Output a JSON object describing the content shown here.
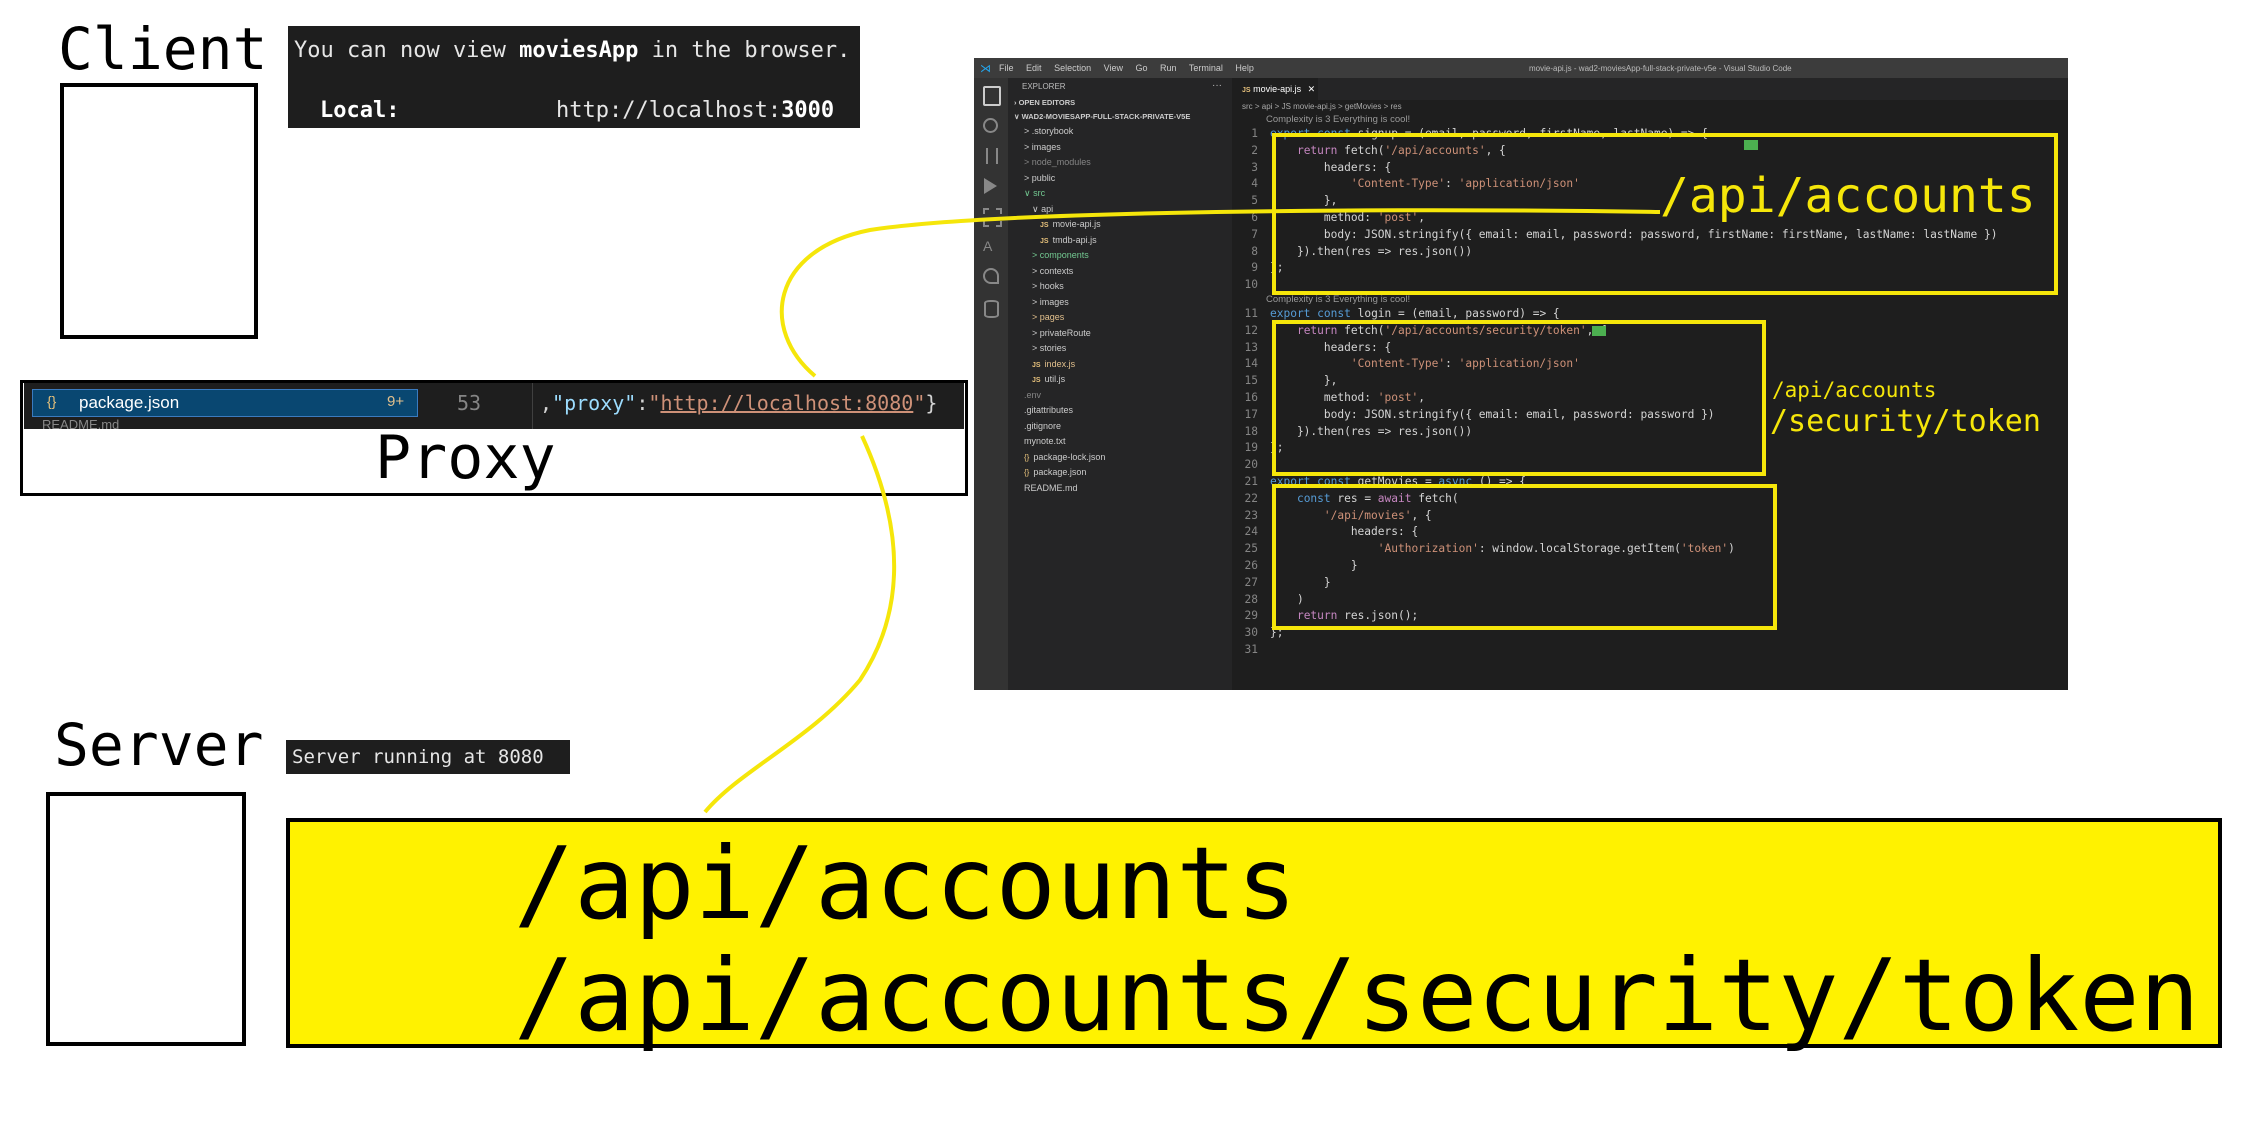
{
  "client": {
    "label": "Client",
    "terminal_line1_pre": "You can now view ",
    "terminal_line1_app": "moviesApp",
    "terminal_line1_post": " in the browser.",
    "terminal_local_label": "Local:",
    "terminal_local_url_pre": "http://localhost:",
    "terminal_local_url_port": "3000"
  },
  "proxy": {
    "label": "Proxy",
    "file_name": "package.json",
    "file_badge": "9+",
    "line_number": "53",
    "code_prefix": ",",
    "code_key": "\"proxy\"",
    "code_colon": ":",
    "code_value_quote_open": "\"",
    "code_value": "http://localhost:8080",
    "code_value_quote_close": "\"",
    "code_suffix": "}",
    "next_file_partial": "README.md"
  },
  "server": {
    "label": "Server",
    "terminal_text": "Server running at 8080"
  },
  "routes_box": {
    "line1": "/api/accounts",
    "line2": "/api/accounts/security/token"
  },
  "vscode": {
    "menu": [
      "File",
      "Edit",
      "Selection",
      "View",
      "Go",
      "Run",
      "Terminal",
      "Help"
    ],
    "window_title": "movie-api.js - wad2-moviesApp-full-stack-private-v5e - Visual Studio Code",
    "explorer_title": "EXPLORER",
    "open_editors": "OPEN EDITORS",
    "project_root": "WAD2-MOVIESAPP-FULL-STACK-PRIVATE-V5E",
    "tree": [
      {
        "label": "> .storybook",
        "indent": 1,
        "kind": "folder"
      },
      {
        "label": "> images",
        "indent": 1,
        "kind": "folder"
      },
      {
        "label": "> node_modules",
        "indent": 1,
        "kind": "muted"
      },
      {
        "label": "> public",
        "indent": 1,
        "kind": "folder"
      },
      {
        "label": "∨ src",
        "indent": 1,
        "kind": "green"
      },
      {
        "label": "∨ api",
        "indent": 2,
        "kind": "folder"
      },
      {
        "label": "movie-api.js",
        "indent": 3,
        "kind": "js"
      },
      {
        "label": "tmdb-api.js",
        "indent": 3,
        "kind": "js"
      },
      {
        "label": "> components",
        "indent": 2,
        "kind": "green"
      },
      {
        "label": "> contexts",
        "indent": 2,
        "kind": "folder"
      },
      {
        "label": "> hooks",
        "indent": 2,
        "kind": "folder"
      },
      {
        "label": "> images",
        "indent": 2,
        "kind": "folder"
      },
      {
        "label": "> pages",
        "indent": 2,
        "kind": "yellow"
      },
      {
        "label": "> privateRoute",
        "indent": 2,
        "kind": "folder"
      },
      {
        "label": "> stories",
        "indent": 2,
        "kind": "folder"
      },
      {
        "label": "index.js",
        "indent": 2,
        "kind": "jsy"
      },
      {
        "label": "util.js",
        "indent": 2,
        "kind": "js"
      },
      {
        "label": ".env",
        "indent": 1,
        "kind": "muted"
      },
      {
        "label": ".gitattributes",
        "indent": 1,
        "kind": "other"
      },
      {
        "label": ".gitignore",
        "indent": 1,
        "kind": "other"
      },
      {
        "label": "mynote.txt",
        "indent": 1,
        "kind": "other"
      },
      {
        "label": "package-lock.json",
        "indent": 1,
        "kind": "json"
      },
      {
        "label": "package.json",
        "indent": 1,
        "kind": "json"
      },
      {
        "label": "README.md",
        "indent": 1,
        "kind": "other"
      }
    ],
    "tab_name": "movie-api.js",
    "breadcrumb": "src > api > JS movie-api.js > getMovies > res",
    "codelens1": "Complexity is 3 Everything is cool!",
    "codelens2": "Complexity is 3 Everything is cool!",
    "code": [
      {
        "n": "1",
        "t": "export const signup = (email, password, firstName, lastName) => {"
      },
      {
        "n": "2",
        "t": "    return fetch('/api/accounts', {"
      },
      {
        "n": "3",
        "t": "        headers: {"
      },
      {
        "n": "4",
        "t": "            'Content-Type': 'application/json'"
      },
      {
        "n": "5",
        "t": "        },"
      },
      {
        "n": "6",
        "t": "        method: 'post',"
      },
      {
        "n": "7",
        "t": "        body: JSON.stringify({ email: email, password: password, firstName: firstName, lastName: lastName })"
      },
      {
        "n": "8",
        "t": "    }).then(res => res.json())"
      },
      {
        "n": "9",
        "t": "};"
      },
      {
        "n": "10",
        "t": ""
      },
      {
        "n": "11",
        "t": "export const login = (email, password) => {"
      },
      {
        "n": "12",
        "t": "    return fetch('/api/accounts/security/token', {"
      },
      {
        "n": "13",
        "t": "        headers: {"
      },
      {
        "n": "14",
        "t": "            'Content-Type': 'application/json'"
      },
      {
        "n": "15",
        "t": "        },"
      },
      {
        "n": "16",
        "t": "        method: 'post',"
      },
      {
        "n": "17",
        "t": "        body: JSON.stringify({ email: email, password: password })"
      },
      {
        "n": "18",
        "t": "    }).then(res => res.json())"
      },
      {
        "n": "19",
        "t": "};"
      },
      {
        "n": "20",
        "t": ""
      },
      {
        "n": "21",
        "t": "export const getMovies = async () => {"
      },
      {
        "n": "22",
        "t": "    const res = await fetch("
      },
      {
        "n": "23",
        "t": "        '/api/movies', {"
      },
      {
        "n": "24",
        "t": "            headers: {"
      },
      {
        "n": "25",
        "t": "                'Authorization': window.localStorage.getItem('token')"
      },
      {
        "n": "26",
        "t": "            }"
      },
      {
        "n": "27",
        "t": "        }"
      },
      {
        "n": "28",
        "t": "    )"
      },
      {
        "n": "29",
        "t": "    return res.json();"
      },
      {
        "n": "30",
        "t": "};"
      },
      {
        "n": "31",
        "t": ""
      }
    ]
  },
  "annotations": {
    "signup_route": "/api/accounts",
    "login_route_line1": "/api/accounts",
    "login_route_line2": "/security/token"
  },
  "colors": {
    "highlight_yellow": "#f5e60a",
    "routes_box_fill": "#fff200"
  }
}
